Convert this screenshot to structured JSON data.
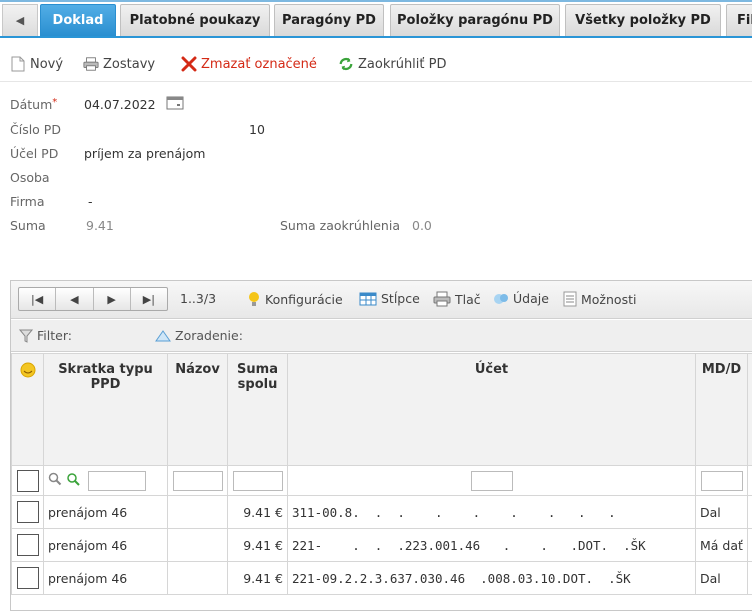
{
  "tabs": [
    {
      "label": "Doklad",
      "active": true
    },
    {
      "label": "Platobné poukazy"
    },
    {
      "label": "Paragóny PD"
    },
    {
      "label": "Položky paragónu PD"
    },
    {
      "label": "Všetky položky PD"
    },
    {
      "label": "Fil"
    }
  ],
  "toolbar": {
    "new_label": "Nový",
    "reports_label": "Zostavy",
    "delete_label": "Zmazať označené",
    "round_label": "Zaokrúhliť PD"
  },
  "form": {
    "datum_label": "Dátum",
    "datum_required": "*",
    "datum_value": "04.07.2022",
    "cislo_label": "Číslo PD",
    "cislo_value": "10",
    "ucel_label": "Účel PD",
    "ucel_value": "príjem za prenájom",
    "osoba_label": "Osoba",
    "osoba_value": "",
    "firma_label": "Firma",
    "firma_value": "-",
    "suma_label": "Suma",
    "suma_value": "9.41",
    "suma_zaokr_label": "Suma zaokrúhlenia",
    "suma_zaokr_value": "0.0"
  },
  "pager": {
    "range": "1..3/3",
    "config_label": "Konfigurácie",
    "columns_label": "Stĺpce",
    "print_label": "Tlač",
    "data_label": "Údaje",
    "options_label": "Možnosti"
  },
  "filterbar": {
    "filter_label": "Filter:",
    "sort_label": "Zoradenie:"
  },
  "columns": {
    "skratka": "Skratka typu PPD",
    "nazov": "Názov",
    "suma": "Suma spolu",
    "ucet": "Účet",
    "mdd": "MD/D"
  },
  "rows": [
    {
      "skratka": "prenájom 46",
      "nazov": "",
      "suma": "9.41 €",
      "ucet": "311-00.8.  .  .    .    .    .    .   .   .",
      "mdd": "Dal"
    },
    {
      "skratka": "prenájom 46",
      "nazov": "",
      "suma": "9.41 €",
      "ucet": "221-    .  .  .223.001.46   .    .   .DOT.  .ŠK",
      "mdd": "Má dať"
    },
    {
      "skratka": "prenájom 46",
      "nazov": "",
      "suma": "9.41 €",
      "ucet": "221-09.2.2.3.637.030.46  .008.03.10.DOT.  .ŠK",
      "mdd": "Dal"
    }
  ],
  "colors": {
    "tab_active": "#2a8fd0",
    "delete_red": "#d42a16"
  }
}
